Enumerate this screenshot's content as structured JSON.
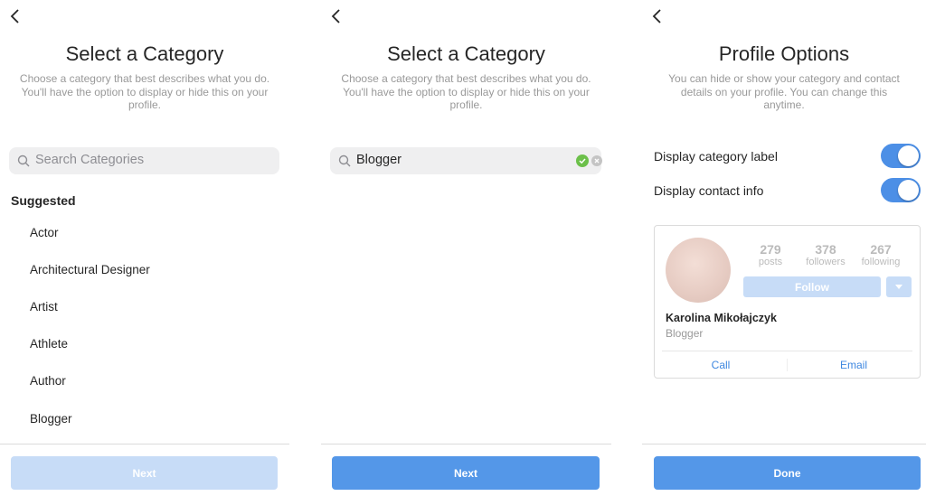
{
  "screen1": {
    "title": "Select a Category",
    "subtitle": "Choose a category that best describes what you do. You'll have the option to display or hide this on your profile.",
    "search_placeholder": "Search Categories",
    "suggested_label": "Suggested",
    "items": [
      "Actor",
      "Architectural Designer",
      "Artist",
      "Athlete",
      "Author",
      "Blogger"
    ],
    "next_label": "Next"
  },
  "screen2": {
    "title": "Select a Category",
    "subtitle": "Choose a category that best describes what you do. You'll have the option to display or hide this on your profile.",
    "search_value": "Blogger",
    "next_label": "Next"
  },
  "screen3": {
    "title": "Profile Options",
    "subtitle": "You can hide or show your category and contact details on your profile. You can change this anytime.",
    "toggles": [
      {
        "label": "Display category label",
        "on": true
      },
      {
        "label": "Display contact info",
        "on": true
      }
    ],
    "preview": {
      "posts": "279",
      "posts_label": "posts",
      "followers": "378",
      "followers_label": "followers",
      "following": "267",
      "following_label": "following",
      "follow_label": "Follow",
      "name": "Karolina Mikołajczyk",
      "category": "Blogger",
      "call_label": "Call",
      "email_label": "Email"
    },
    "done_label": "Done"
  },
  "colors": {
    "accent": "#5497e8",
    "disabled": "#c7dcf7",
    "valid": "#6cc04a"
  }
}
